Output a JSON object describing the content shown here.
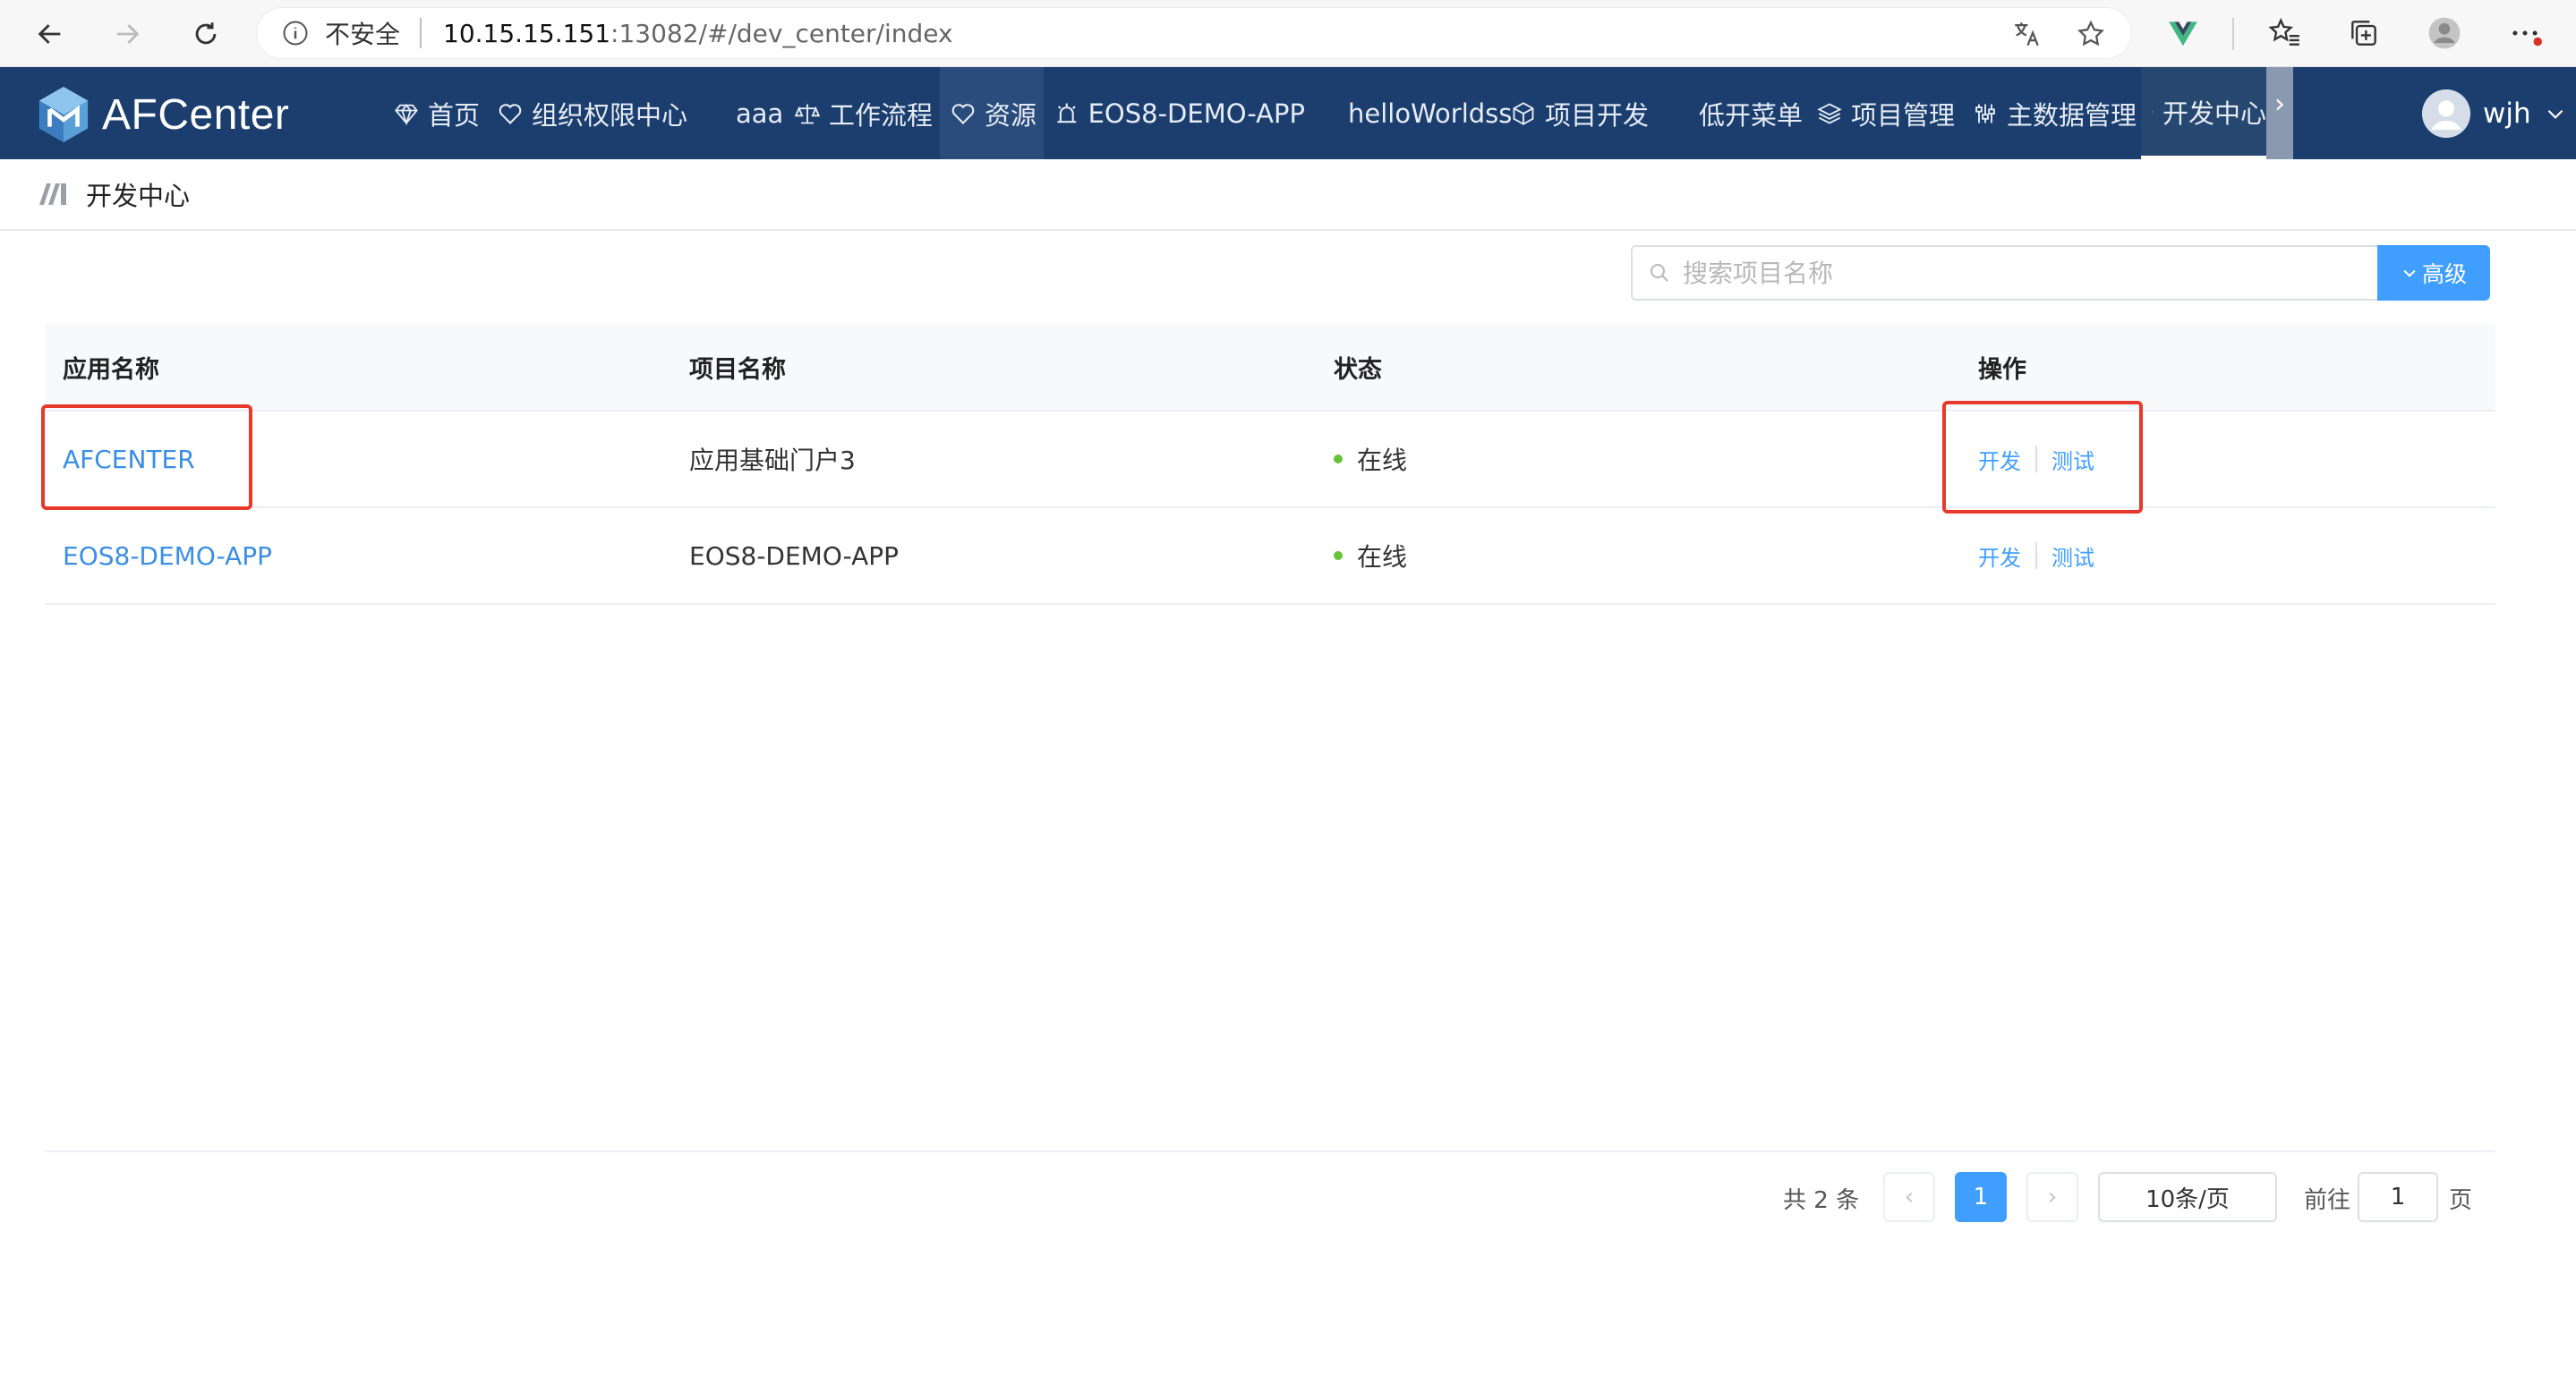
{
  "browser": {
    "security_label": "不安全",
    "url_host": "10.15.15.151",
    "url_rest": ":13082/#/dev_center/index"
  },
  "app": {
    "logo_text": "AFCenter",
    "menu": [
      {
        "label": "首页",
        "icon": "gem-icon"
      },
      {
        "label": "组织权限中心",
        "icon": "heart-icon"
      },
      {
        "label": "aaa",
        "icon": ""
      },
      {
        "label": "工作流程",
        "icon": "scale-icon"
      },
      {
        "label": "资源",
        "icon": "heart-icon"
      },
      {
        "label": "EOS8-DEMO-APP",
        "icon": "alarm-icon"
      },
      {
        "label": "helloWorldss",
        "icon": ""
      },
      {
        "label": "项目开发",
        "icon": "cube-icon"
      },
      {
        "label": "低开菜单",
        "icon": ""
      },
      {
        "label": "项目管理",
        "icon": "layers-icon"
      },
      {
        "label": "主数据管理",
        "icon": "sliders-icon"
      },
      {
        "label": "开发中心",
        "icon": "edit-icon"
      }
    ],
    "user_name": "wjh"
  },
  "breadcrumb": {
    "title": "开发中心"
  },
  "search": {
    "placeholder": "搜索项目名称",
    "advanced_label": "高级"
  },
  "table": {
    "headers": [
      "应用名称",
      "项目名称",
      "状态",
      "操作"
    ],
    "rows": [
      {
        "app_name": "AFCENTER",
        "project_name": "应用基础门户3",
        "status": "在线",
        "actions": [
          "开发",
          "测试"
        ]
      },
      {
        "app_name": "EOS8-DEMO-APP",
        "project_name": "EOS8-DEMO-APP",
        "status": "在线",
        "actions": [
          "开发",
          "测试"
        ]
      }
    ]
  },
  "pagination": {
    "total_text": "共 2 条",
    "current_page": "1",
    "page_size": "10条/页",
    "goto_label": "前往",
    "goto_value": "1",
    "page_unit": "页"
  },
  "colors": {
    "header_bg": "#1b3e6f",
    "primary": "#409eff",
    "status_online": "#67c23a",
    "annotation": "#e8382c"
  }
}
